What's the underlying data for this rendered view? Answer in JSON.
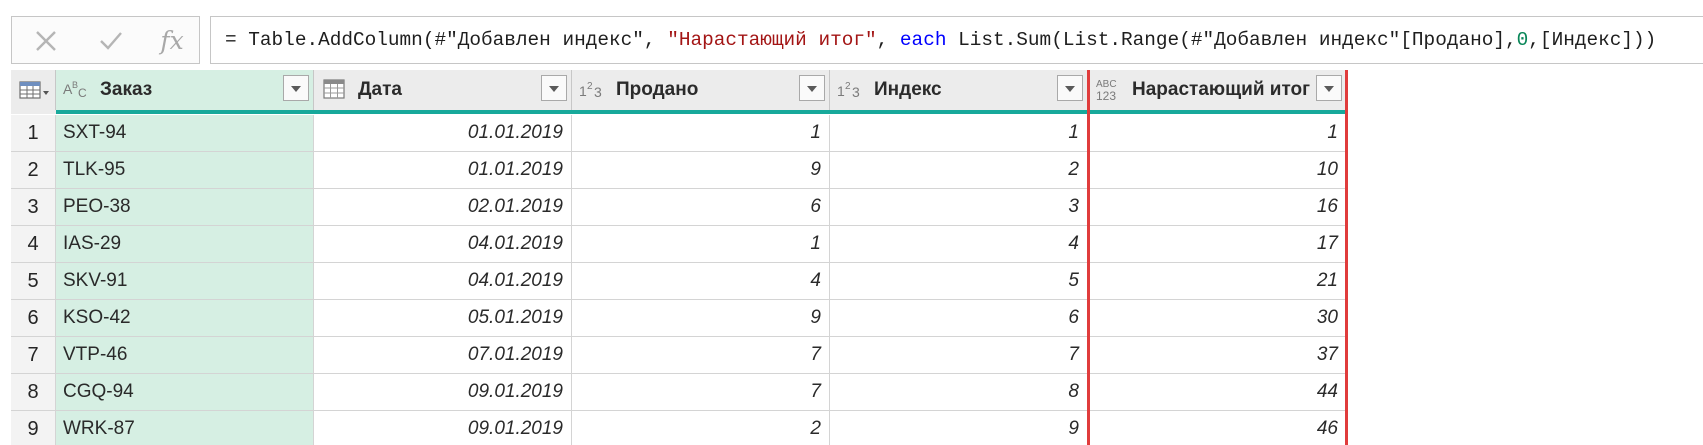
{
  "formula_bar": {
    "cancel_icon": "close-icon",
    "commit_icon": "check-icon",
    "fx_label": "fx",
    "formula": {
      "prefix": "= Table.AddColumn(#\"Добавлен индекс\", ",
      "new_col_name": "\"Нарастающий итог\"",
      "sep": ", ",
      "keyword": "each",
      "middle": " List.Sum(List.Range(#\"Добавлен индекс\"[Продано],",
      "number": "0",
      "suffix": ",[Индекс]))"
    }
  },
  "grid": {
    "columns": [
      {
        "label": "Заказ",
        "type": "text",
        "type_icon": "ABC-type-icon"
      },
      {
        "label": "Дата",
        "type": "date",
        "type_icon": "calendar-type-icon"
      },
      {
        "label": "Продано",
        "type": "integer",
        "type_icon": "123-type-icon"
      },
      {
        "label": "Индекс",
        "type": "integer",
        "type_icon": "123-type-icon"
      },
      {
        "label": "Нарастающий итог",
        "type": "any",
        "type_icon": "ABC123-type-icon"
      }
    ],
    "rows": [
      {
        "n": "1",
        "order": "SXT-94",
        "date": "01.01.2019",
        "sold": "1",
        "index": "1",
        "cum": "1"
      },
      {
        "n": "2",
        "order": "TLK-95",
        "date": "01.01.2019",
        "sold": "9",
        "index": "2",
        "cum": "10"
      },
      {
        "n": "3",
        "order": "PEO-38",
        "date": "02.01.2019",
        "sold": "6",
        "index": "3",
        "cum": "16"
      },
      {
        "n": "4",
        "order": "IAS-29",
        "date": "04.01.2019",
        "sold": "1",
        "index": "4",
        "cum": "17"
      },
      {
        "n": "5",
        "order": "SKV-91",
        "date": "04.01.2019",
        "sold": "4",
        "index": "5",
        "cum": "21"
      },
      {
        "n": "6",
        "order": "KSO-42",
        "date": "05.01.2019",
        "sold": "9",
        "index": "6",
        "cum": "30"
      },
      {
        "n": "7",
        "order": "VTP-46",
        "date": "07.01.2019",
        "sold": "7",
        "index": "7",
        "cum": "37"
      },
      {
        "n": "8",
        "order": "CGQ-94",
        "date": "09.01.2019",
        "sold": "7",
        "index": "8",
        "cum": "44"
      },
      {
        "n": "9",
        "order": "WRK-87",
        "date": "09.01.2019",
        "sold": "2",
        "index": "9",
        "cum": "46"
      }
    ]
  },
  "colors": {
    "selected_column_bg": "#d6efe3",
    "teal_quality_bar": "#17a99b",
    "highlight_border": "#e03c3c",
    "keyword_blue": "#0000ff",
    "string_red": "#a31515",
    "number_green": "#098658"
  }
}
